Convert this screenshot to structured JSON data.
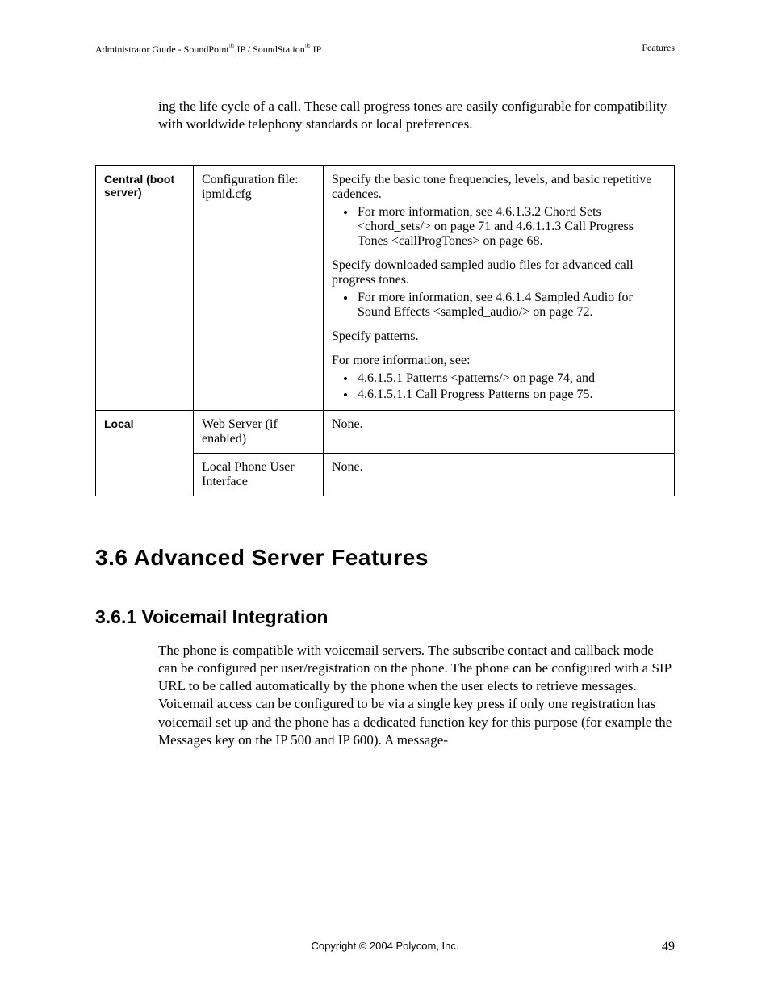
{
  "header": {
    "left_prefix": "Administrator Guide - SoundPoint",
    "reg": "®",
    "left_mid": " IP / SoundStation",
    "left_suffix": " IP",
    "right": "Features"
  },
  "intro": "ing the life cycle of a call.  These call progress tones are easily configurable for compatibility with worldwide telephony standards or local preferences.",
  "table": {
    "row1": {
      "col1": "Central (boot server)",
      "col2": "Configuration file: ipmid.cfg",
      "block1_text": "Specify the basic tone frequencies, levels, and basic repetitive cadences.",
      "block1_bullet1": "For more information, see 4.6.1.3.2 Chord Sets <chord_sets/> on page 71 and 4.6.1.1.3 Call Progress Tones <callProgTones> on page 68.",
      "block2_text": "Specify downloaded sampled audio files for advanced call progress tones.",
      "block2_bullet1": "For more information, see 4.6.1.4 Sampled Audio for Sound Effects <sampled_audio/> on page 72.",
      "block3_text": "Specify patterns.",
      "block4_text": "For more information, see:",
      "block4_bullet1": "4.6.1.5.1 Patterns <patterns/> on page 74, and",
      "block4_bullet2": "4.6.1.5.1.1 Call Progress Patterns on page 75."
    },
    "row2": {
      "col1": "Local",
      "col2a": "Web Server (if enabled)",
      "col3a": "None.",
      "col2b": "Local Phone User Interface",
      "col3b": "None."
    }
  },
  "section_heading": "3.6  Advanced Server Features",
  "subsection_heading": "3.6.1  Voicemail Integration",
  "body": "The phone is compatible with voicemail servers.  The subscribe contact and callback mode can be configured per user/registration on the phone.  The phone can be configured with a SIP URL to be called automatically by the phone when the user elects to retrieve messages.  Voicemail access can be configured to be via a single key press if only one registration has voicemail set up and the phone has a dedicated function key for this purpose (for example the Messages key on the IP 500 and IP 600).  A message-",
  "footer": {
    "copyright": "Copyright © 2004 Polycom, Inc.",
    "page": "49"
  }
}
